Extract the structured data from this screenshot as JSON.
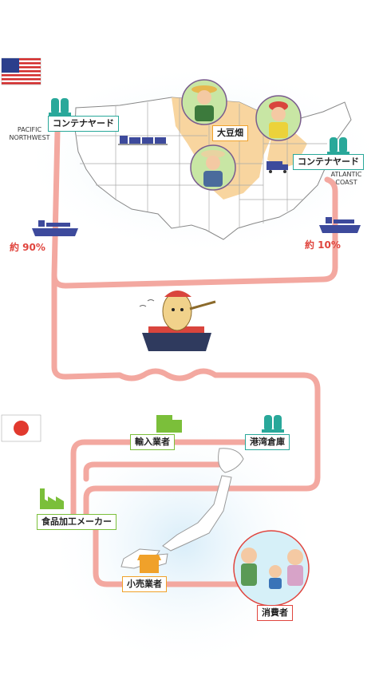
{
  "usa": {
    "flag_icon": "usa-flag-icon",
    "sea_west": "PACIFIC\nNORTHWEST",
    "sea_east": "ATLANTIC\nCOAST",
    "yard_west": "コンテナヤード",
    "yard_east": "コンテナヤード",
    "field": "大豆畑",
    "share_west": "約 90%",
    "share_east": "約 10%"
  },
  "japan": {
    "flag_icon": "japan-flag-icon",
    "importer": "輸入業者",
    "port_warehouse": "港湾倉庫",
    "food_maker": "食品加工メーカー",
    "retailer": "小売業者",
    "consumer": "消費者"
  },
  "colors": {
    "route": "#f3a8a0",
    "highlight": "#f8d39a",
    "teal": "#29a89a",
    "green": "#7bbf3a",
    "orange": "#f0a12a",
    "red": "#e0453e",
    "land": "#ffffff",
    "glow": "#d8edf9"
  }
}
